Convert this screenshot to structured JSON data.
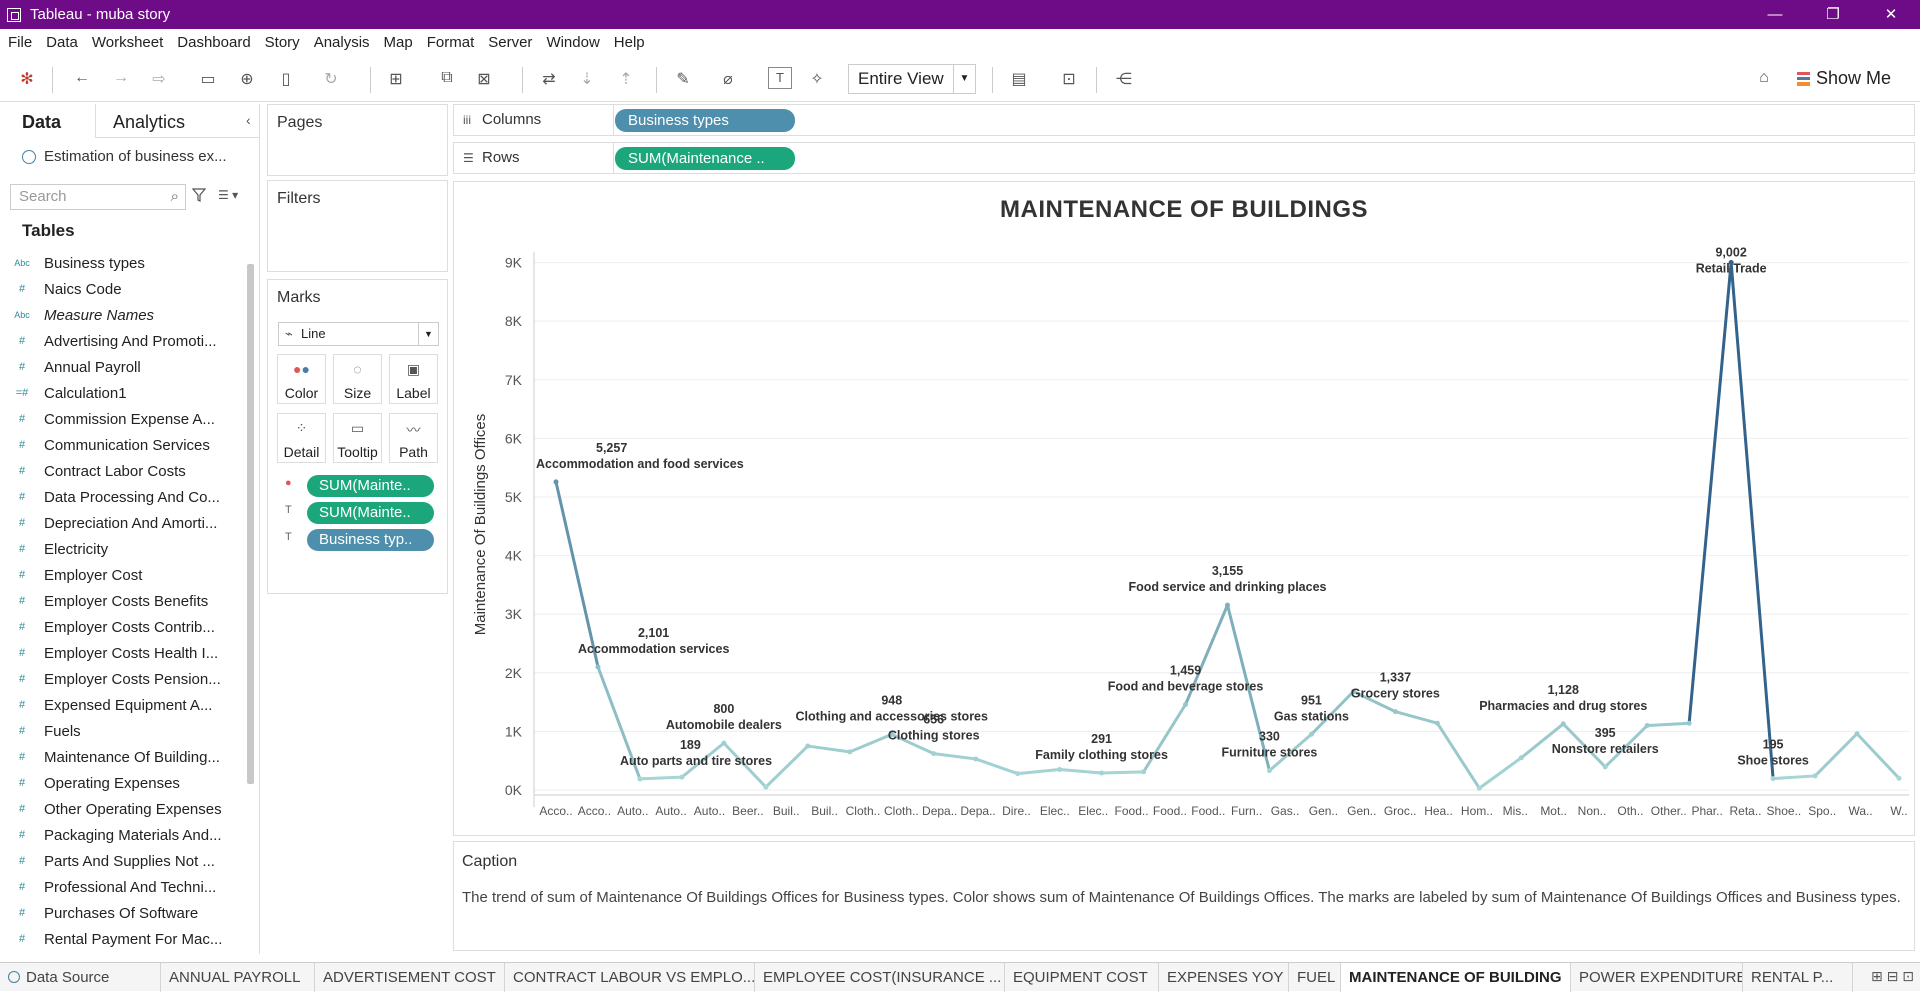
{
  "window": {
    "title": "Tableau - muba story",
    "minimize": "—",
    "restore": "❐",
    "close": "✕"
  },
  "menu": [
    "File",
    "Data",
    "Worksheet",
    "Dashboard",
    "Story",
    "Analysis",
    "Map",
    "Format",
    "Server",
    "Window",
    "Help"
  ],
  "toolbar": {
    "fit": "Entire View",
    "show_me": "Show Me"
  },
  "data_pane": {
    "tab_data": "Data",
    "tab_analytics": "Analytics",
    "datasource": "Estimation of business ex...",
    "search_placeholder": "Search",
    "tables_heading": "Tables",
    "fields": [
      {
        "name": "Business types",
        "type": "Abc"
      },
      {
        "name": "Naics Code",
        "type": "#"
      },
      {
        "name": "Measure Names",
        "type": "Abc"
      },
      {
        "name": "Advertising And Promoti...",
        "type": "#"
      },
      {
        "name": "Annual Payroll",
        "type": "#"
      },
      {
        "name": "Calculation1",
        "type": "=#"
      },
      {
        "name": "Commission Expense A...",
        "type": "#"
      },
      {
        "name": "Communication Services",
        "type": "#"
      },
      {
        "name": "Contract Labor Costs",
        "type": "#"
      },
      {
        "name": "Data Processing And Co...",
        "type": "#"
      },
      {
        "name": "Depreciation And Amorti...",
        "type": "#"
      },
      {
        "name": "Electricity",
        "type": "#"
      },
      {
        "name": "Employer Cost",
        "type": "#"
      },
      {
        "name": "Employer Costs Benefits",
        "type": "#"
      },
      {
        "name": "Employer Costs Contrib...",
        "type": "#"
      },
      {
        "name": "Employer Costs Health I...",
        "type": "#"
      },
      {
        "name": "Employer Costs Pension...",
        "type": "#"
      },
      {
        "name": "Expensed Equipment A...",
        "type": "#"
      },
      {
        "name": "Fuels",
        "type": "#"
      },
      {
        "name": "Maintenance Of Building...",
        "type": "#"
      },
      {
        "name": "Operating Expenses",
        "type": "#"
      },
      {
        "name": "Other Operating Expenses",
        "type": "#"
      },
      {
        "name": "Packaging Materials And...",
        "type": "#"
      },
      {
        "name": "Parts And Supplies Not ...",
        "type": "#"
      },
      {
        "name": "Professional And Techni...",
        "type": "#"
      },
      {
        "name": "Purchases Of Software",
        "type": "#"
      },
      {
        "name": "Rental Payment For Mac...",
        "type": "#"
      }
    ]
  },
  "cards": {
    "pages": "Pages",
    "filters": "Filters",
    "marks": "Marks",
    "mark_type": "Line",
    "buttons": [
      "Color",
      "Size",
      "Label",
      "Detail",
      "Tooltip",
      "Path"
    ],
    "mark_pills": [
      "SUM(Mainte..",
      "SUM(Mainte..",
      "Business typ.."
    ]
  },
  "shelves": {
    "columns_label": "Columns",
    "columns_pill": "Business types",
    "rows_label": "Rows",
    "rows_pill": "SUM(Maintenance .."
  },
  "colors": {
    "title_bar": "#6e0b86",
    "line_light": "#a9d8d6",
    "line_dark": "#2f5f8a",
    "pill_green": "#1ba77b",
    "pill_blue": "#4e8fad"
  },
  "chart_data": {
    "type": "line",
    "title": "MAINTENANCE  OF BUILDINGS",
    "ylabel": "Maintenance Of Buildings Offices",
    "ylim": [
      0,
      9300
    ],
    "yticks": [
      "0K",
      "1K",
      "2K",
      "3K",
      "4K",
      "5K",
      "6K",
      "7K",
      "8K",
      "9K"
    ],
    "x_tick_labels": [
      "Acco..",
      "Acco..",
      "Auto..",
      "Auto..",
      "Auto..",
      "Beer..",
      "Buil..",
      "Buil..",
      "Cloth..",
      "Cloth..",
      "Depa..",
      "Depa..",
      "Dire..",
      "Elec..",
      "Elec..",
      "Food..",
      "Food..",
      "Food..",
      "Furn..",
      "Gas..",
      "Gen..",
      "Gen..",
      "Groc..",
      "Hea..",
      "Hom..",
      "Mis..",
      "Mot..",
      "Non..",
      "Oth..",
      "Other..",
      "Phar..",
      "Reta..",
      "Shoe..",
      "Spo..",
      "Wa..",
      "W.."
    ],
    "values": [
      5257,
      2101,
      189,
      220,
      800,
      50,
      750,
      650,
      948,
      620,
      530,
      280,
      350,
      291,
      310,
      1459,
      3155,
      330,
      951,
      1680,
      1337,
      1140,
      30,
      550,
      1128,
      395,
      1100,
      1140,
      9002,
      195,
      240,
      960,
      200
    ],
    "annotations": [
      {
        "value": "5,257",
        "label": "Accommodation and food services"
      },
      {
        "value": "2,101",
        "label": "Accommodation services"
      },
      {
        "value": "189",
        "label": "Auto parts and tire stores"
      },
      {
        "value": "800",
        "label": "Automobile dealers"
      },
      {
        "value": "948",
        "label": "Clothing and accessories stores"
      },
      {
        "value": "656",
        "label": "Clothing stores"
      },
      {
        "value": "291",
        "label": "Family clothing stores"
      },
      {
        "value": "1,459",
        "label": "Food and beverage stores"
      },
      {
        "value": "3,155",
        "label": "Food service and drinking places"
      },
      {
        "value": "330",
        "label": "Furniture stores"
      },
      {
        "value": "951",
        "label": "Gas stations"
      },
      {
        "value": "1,337",
        "label": "Grocery stores"
      },
      {
        "value": "1,128",
        "label": "Pharmacies and drug stores"
      },
      {
        "value": "395",
        "label": "Nonstore retailers"
      },
      {
        "value": "9,002",
        "label": "Retail Trade"
      },
      {
        "value": "195",
        "label": "Shoe stores"
      }
    ]
  },
  "caption": {
    "heading": "Caption",
    "text": "The trend of sum of Maintenance Of Buildings Offices for Business types.  Color shows sum of Maintenance Of Buildings Offices.  The marks are labeled by sum of Maintenance Of Buildings Offices and Business types."
  },
  "sheets": {
    "data_source": "Data Source",
    "tabs": [
      "ANNUAL PAYROLL",
      "ADVERTISEMENT COST",
      "CONTRACT LABOUR VS EMPLO...",
      "EMPLOYEE COST(INSURANCE ...",
      "EQUIPMENT COST",
      "EXPENSES YOY",
      "FUEL",
      "MAINTENANCE OF BUILDING",
      "POWER EXPENDITURE",
      "RENTAL P..."
    ],
    "active": "MAINTENANCE OF BUILDING"
  }
}
